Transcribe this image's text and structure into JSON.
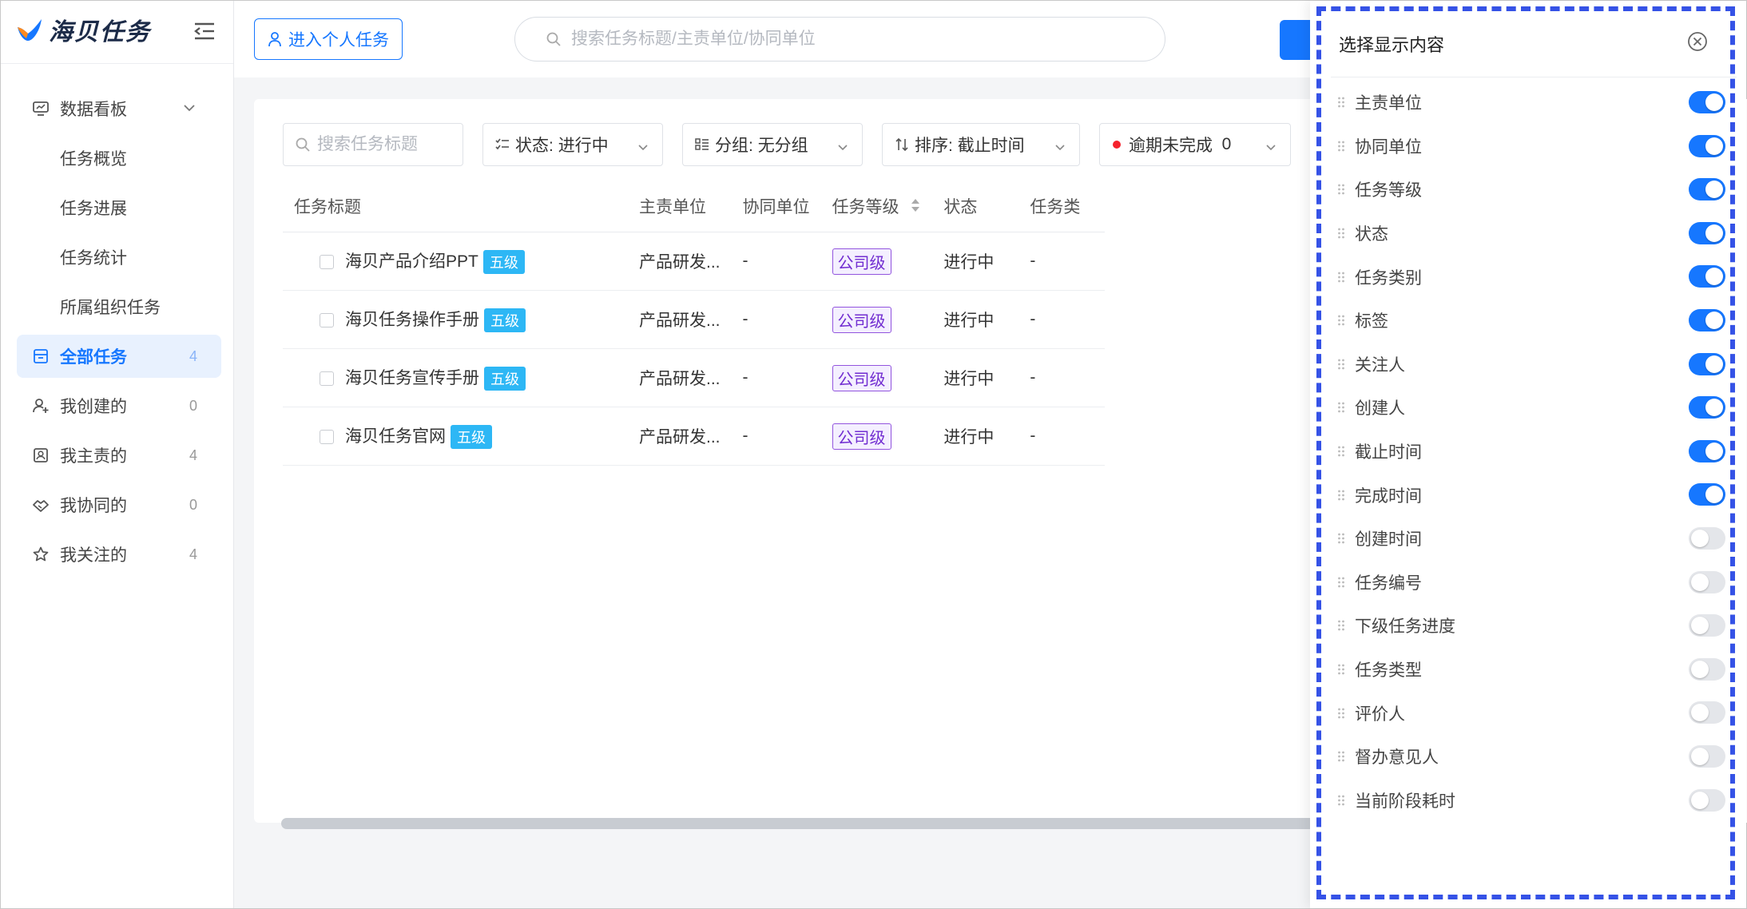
{
  "app": {
    "name": "海贝任务"
  },
  "sidebar": {
    "group": {
      "label": "数据看板"
    },
    "subitems": [
      {
        "label": "任务概览"
      },
      {
        "label": "任务进展"
      },
      {
        "label": "任务统计"
      },
      {
        "label": "所属组织任务"
      }
    ],
    "items": [
      {
        "label": "全部任务",
        "count": "4",
        "icon": "inbox-icon",
        "active": true
      },
      {
        "label": "我创建的",
        "count": "0",
        "icon": "user-add-icon"
      },
      {
        "label": "我主责的",
        "count": "4",
        "icon": "id-card-icon"
      },
      {
        "label": "我协同的",
        "count": "0",
        "icon": "handshake-icon"
      },
      {
        "label": "我关注的",
        "count": "4",
        "icon": "star-icon"
      }
    ]
  },
  "header": {
    "personal_button": "进入个人任务",
    "search_placeholder": "搜索任务标题/主责单位/协同单位"
  },
  "filters": {
    "search_placeholder": "搜索任务标题",
    "status": {
      "label": "状态:",
      "value": "进行中"
    },
    "group": {
      "label": "分组:",
      "value": "无分组"
    },
    "sort": {
      "label": "排序:",
      "value": "截止时间"
    },
    "overdue": {
      "label": "逾期未完成",
      "count": "0"
    }
  },
  "table": {
    "columns": [
      "任务标题",
      "主责单位",
      "协同单位",
      "任务等级",
      "状态",
      "任务类"
    ],
    "rows": [
      {
        "title": "海贝产品介绍PPT",
        "level_tag": "五级",
        "unit": "产品研发...",
        "co_unit": "-",
        "grade": "公司级",
        "status": "进行中",
        "type": "-"
      },
      {
        "title": "海贝任务操作手册",
        "level_tag": "五级",
        "unit": "产品研发...",
        "co_unit": "-",
        "grade": "公司级",
        "status": "进行中",
        "type": "-"
      },
      {
        "title": "海贝任务宣传手册",
        "level_tag": "五级",
        "unit": "产品研发...",
        "co_unit": "-",
        "grade": "公司级",
        "status": "进行中",
        "type": "-"
      },
      {
        "title": "海贝任务官网",
        "level_tag": "五级",
        "unit": "产品研发...",
        "co_unit": "-",
        "grade": "公司级",
        "status": "进行中",
        "type": "-"
      }
    ]
  },
  "panel": {
    "title": "选择显示内容",
    "columns": [
      {
        "label": "主责单位",
        "enabled": true
      },
      {
        "label": "协同单位",
        "enabled": true
      },
      {
        "label": "任务等级",
        "enabled": true
      },
      {
        "label": "状态",
        "enabled": true
      },
      {
        "label": "任务类别",
        "enabled": true
      },
      {
        "label": "标签",
        "enabled": true
      },
      {
        "label": "关注人",
        "enabled": true
      },
      {
        "label": "创建人",
        "enabled": true
      },
      {
        "label": "截止时间",
        "enabled": true
      },
      {
        "label": "完成时间",
        "enabled": true
      },
      {
        "label": "创建时间",
        "enabled": false
      },
      {
        "label": "任务编号",
        "enabled": false
      },
      {
        "label": "下级任务进度",
        "enabled": false
      },
      {
        "label": "任务类型",
        "enabled": false
      },
      {
        "label": "评价人",
        "enabled": false
      },
      {
        "label": "督办意见人",
        "enabled": false
      },
      {
        "label": "当前阶段耗时",
        "enabled": false
      }
    ]
  },
  "colors": {
    "primary": "#1677ff",
    "status": "#fa8c16",
    "level_tag": "#2db7f5",
    "grade_tag": "#722ed1",
    "highlight_outline": "#3552e6"
  }
}
